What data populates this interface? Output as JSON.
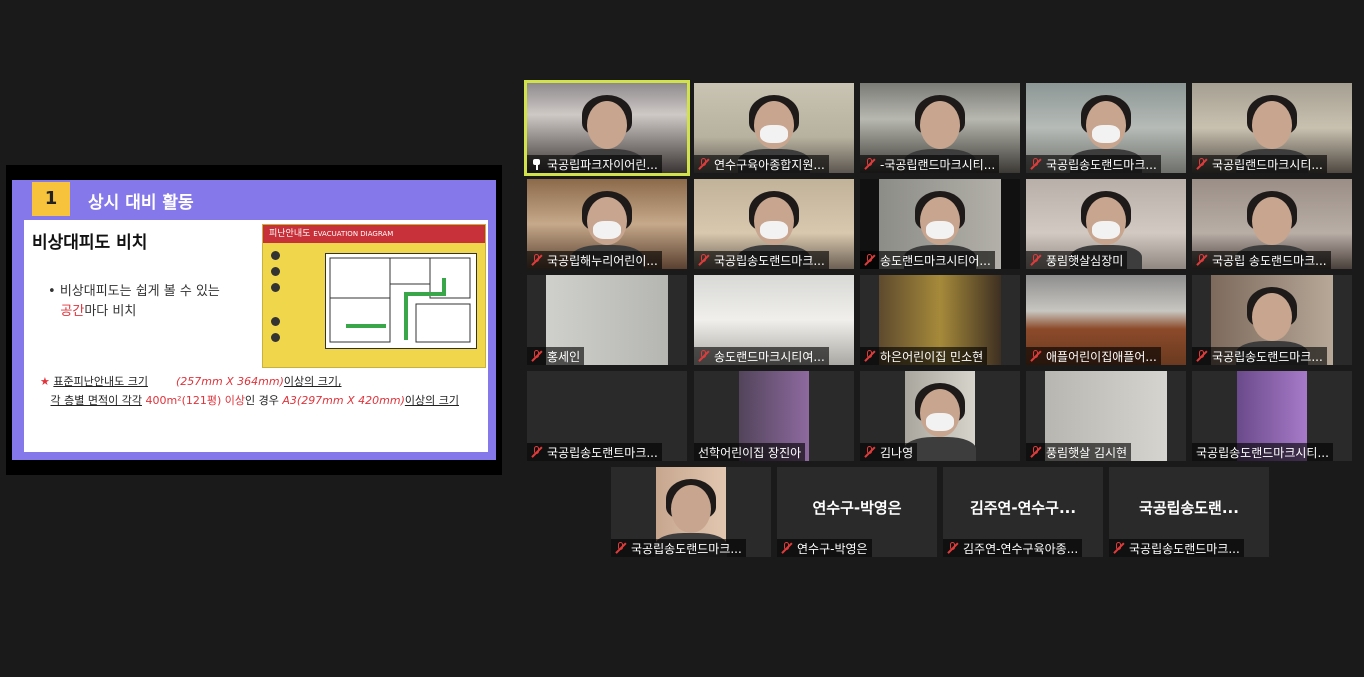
{
  "shared_screen": {
    "slide_number": "1",
    "slide_title": "상시 대비 활동",
    "subtitle": "비상대피도 비치",
    "bullet_line1": "비상대피도는 쉽게 볼 수 있는",
    "bullet_highlight": "공간",
    "bullet_line2_rest": "마다 비치",
    "map_title": "피난안내도",
    "map_title_en": "EVACUATION DIAGRAM",
    "footnote_line1_a": "표준피난안내도 크기",
    "footnote_line1_size": "(257mm X 364mm)",
    "footnote_line1_b": "이상의 크기,",
    "footnote_line2_a": "각 층별 면적이 각각",
    "footnote_line2_area": "400m²(121평) 이상",
    "footnote_line2_b": "인 경우",
    "footnote_line2_size": "A3(297mm X 420mm)",
    "footnote_line2_c": "이상의 크기"
  },
  "participants": [
    {
      "name": "국공립파크자이어린...",
      "muted": false,
      "active": true
    },
    {
      "name": "연수구육아종합지원...",
      "muted": true
    },
    {
      "name": "-국공립랜드마크시티...",
      "muted": true
    },
    {
      "name": "국공립송도랜드마크...",
      "muted": true
    },
    {
      "name": "국공립랜드마크시티...",
      "muted": true
    },
    {
      "name": "국공립해누리어린이...",
      "muted": true
    },
    {
      "name": "국공립송도랜드마크...",
      "muted": true
    },
    {
      "name": "송도랜드마크시티어...",
      "muted": true
    },
    {
      "name": "풍림햇살심장미",
      "muted": true
    },
    {
      "name": "국공립 송도랜드마크...",
      "muted": true
    },
    {
      "name": "홍세인",
      "muted": true
    },
    {
      "name": "송도랜드마크시티여...",
      "muted": true
    },
    {
      "name": "하은어린이집 민소현",
      "muted": true
    },
    {
      "name": "애플어린이집애플어...",
      "muted": true
    },
    {
      "name": "국공립송도랜드마크...",
      "muted": true
    },
    {
      "name": "국공립송도랜트마크...",
      "muted": true
    },
    {
      "name": "선학어린이집 장진아",
      "muted": false
    },
    {
      "name": "김나영",
      "muted": true
    },
    {
      "name": "풍림햇살 김시현",
      "muted": true
    },
    {
      "name": "국공립송도랜드마크시티...",
      "muted": false
    },
    {
      "name": "국공립송도랜드마크...",
      "muted": true
    },
    {
      "name": "연수구-박영은",
      "muted": true,
      "big_label": "연수구-박영은"
    },
    {
      "name": "김주연-연수구육아종...",
      "muted": true,
      "big_label": "김주연-연수구..."
    },
    {
      "name": "국공립송도랜드마크...",
      "muted": true,
      "big_label": "국공립송도랜..."
    }
  ]
}
